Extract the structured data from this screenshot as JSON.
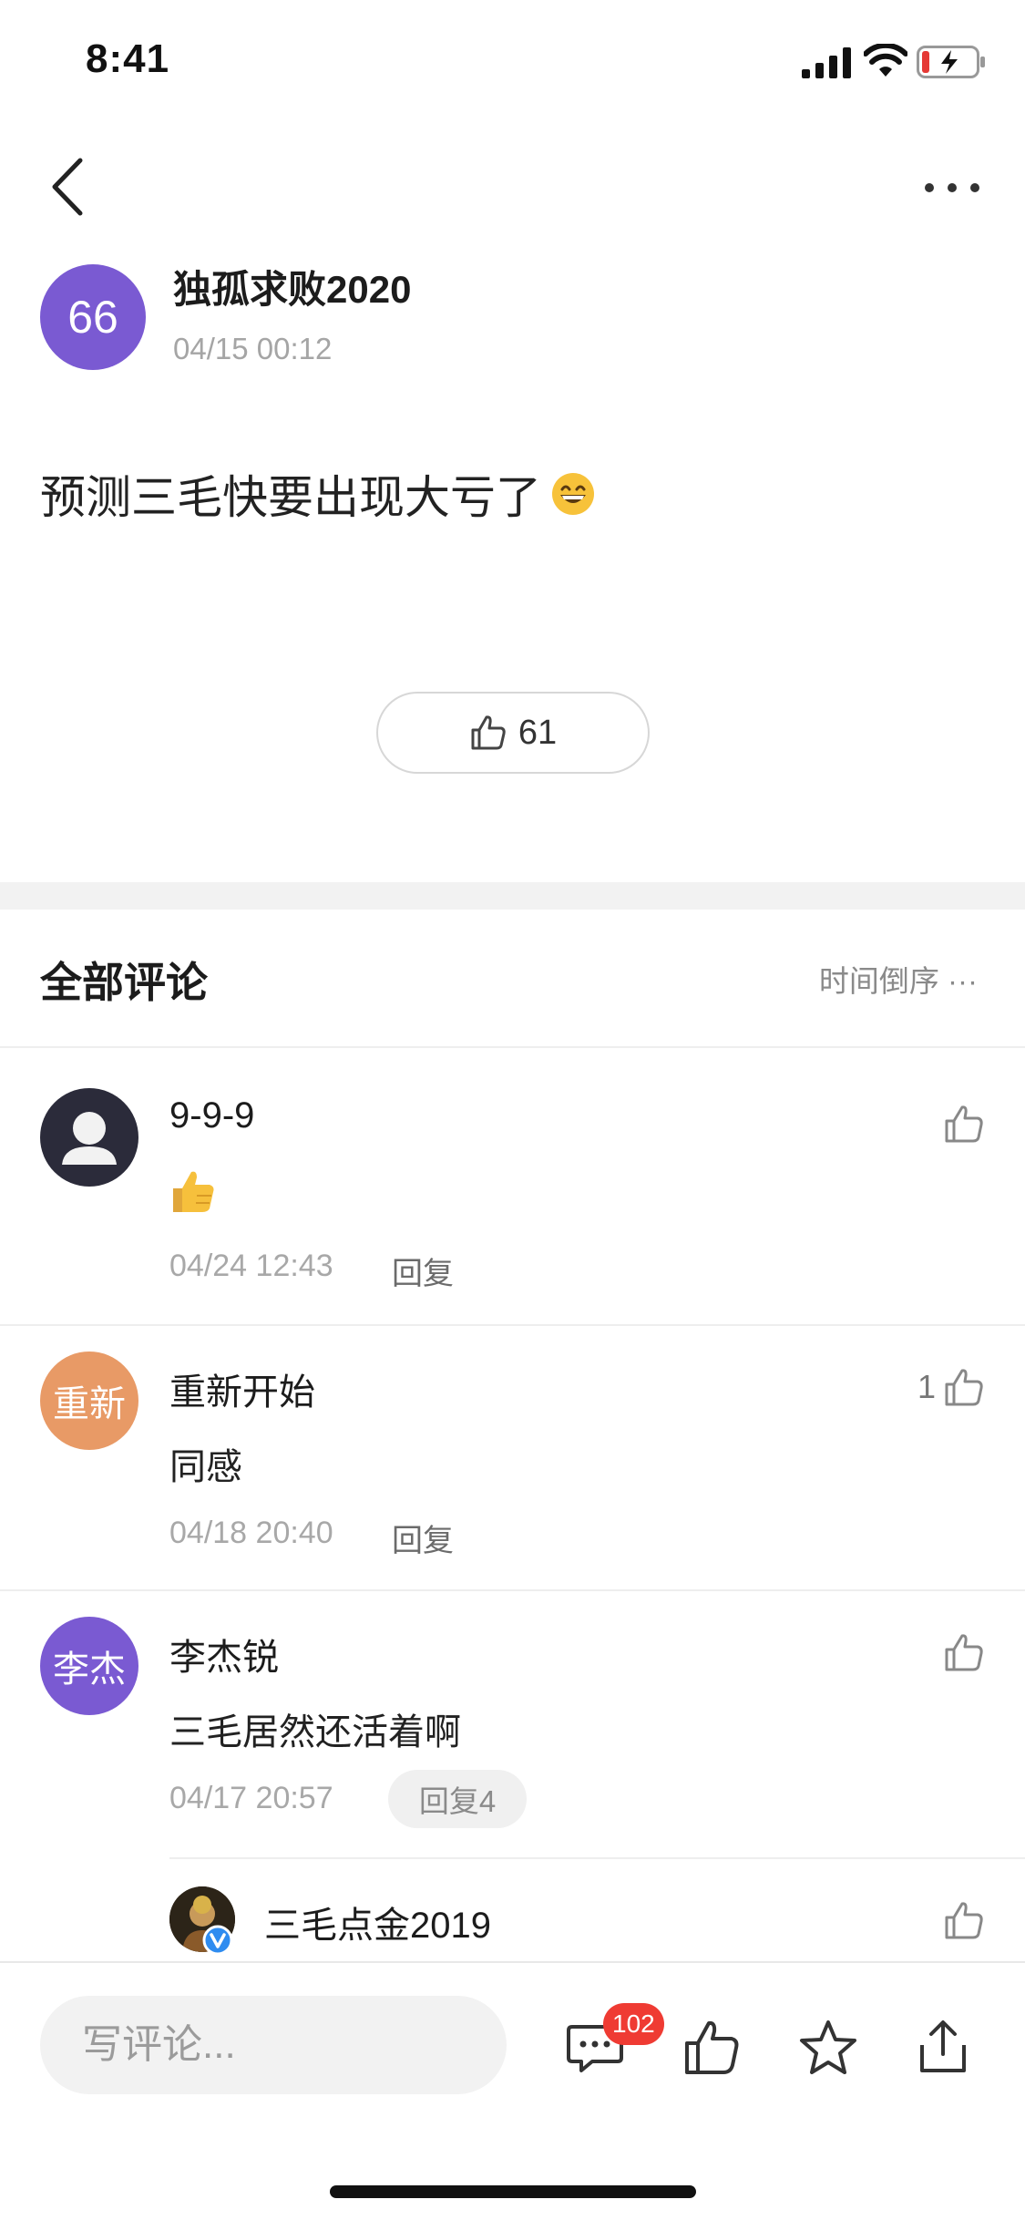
{
  "status_bar": {
    "time": "8:41"
  },
  "author": {
    "avatar_text": "66",
    "avatar_color": "#7a5ad2",
    "name": "独孤求败2020",
    "time": "04/15 00:12"
  },
  "post": {
    "text": "预测三毛快要出现大亏了",
    "emoji": "grinning-face-emoji",
    "like_count": "61"
  },
  "comments_section": {
    "title": "全部评论",
    "sort_label": "时间倒序 ···"
  },
  "comments": [
    {
      "name": "9-9-9",
      "text": "",
      "emoji": "thumbs-up-emoji",
      "time": "04/24 12:43",
      "reply_label": "回复",
      "likes": "",
      "avatar_text": "",
      "avatar_color": "#2b2b3a"
    },
    {
      "name": "重新开始",
      "text": "同感",
      "time": "04/18 20:40",
      "reply_label": "回复",
      "likes": "1",
      "avatar_text": "重新",
      "avatar_color": "#e89a66"
    },
    {
      "name": "李杰锐",
      "text": "三毛居然还活着啊",
      "time": "04/17 20:57",
      "reply_label": "回复4",
      "likes": "",
      "avatar_text": "李杰",
      "avatar_color": "#7a5ad2"
    },
    {
      "name": "三毛点金2019",
      "verified": true
    }
  ],
  "bottom_bar": {
    "input_placeholder": "写评论...",
    "comment_badge": "102",
    "badge_color": "#ef3b33"
  }
}
